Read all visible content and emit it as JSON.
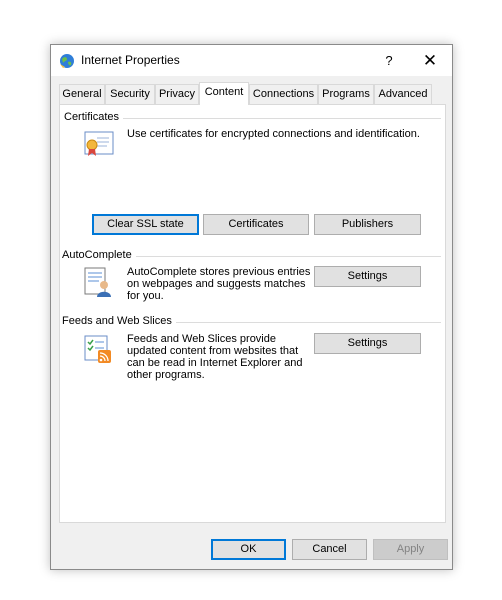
{
  "window": {
    "title": "Internet Properties",
    "help": "?",
    "close": "✕"
  },
  "tabs": [
    {
      "label": "General"
    },
    {
      "label": "Security"
    },
    {
      "label": "Privacy"
    },
    {
      "label": "Content",
      "active": true
    },
    {
      "label": "Connections"
    },
    {
      "label": "Programs"
    },
    {
      "label": "Advanced"
    }
  ],
  "certificates": {
    "group_label": "Certificates",
    "description": "Use certificates for encrypted connections and identification.",
    "clear_ssl_label": "Clear SSL state",
    "certificates_label": "Certificates",
    "publishers_label": "Publishers"
  },
  "autocomplete": {
    "group_label": "AutoComplete",
    "description": "AutoComplete stores previous entries on webpages and suggests matches for you.",
    "settings_label": "Settings"
  },
  "feeds": {
    "group_label": "Feeds and Web Slices",
    "description": "Feeds and Web Slices provide updated content from websites that can be read in Internet Explorer and other programs.",
    "settings_label": "Settings"
  },
  "footer": {
    "ok_label": "OK",
    "cancel_label": "Cancel",
    "apply_label": "Apply"
  },
  "colors": {
    "accent": "#0078d7",
    "dialog_bg": "#f0f0f0",
    "button_bg": "#e1e1e1"
  },
  "icons": {
    "title": "internet-globe-icon",
    "certificates": "certificate-icon",
    "autocomplete": "autocomplete-icon",
    "feeds": "feeds-icon"
  }
}
